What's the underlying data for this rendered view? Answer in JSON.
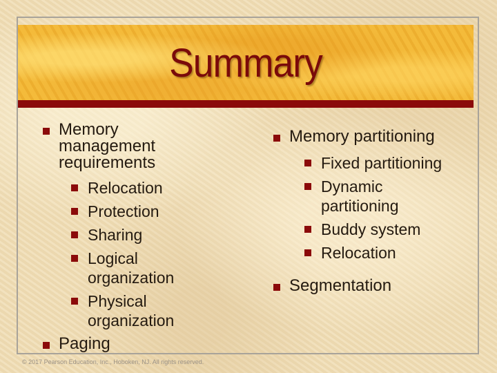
{
  "slide": {
    "title": "Summary",
    "footer": "© 2017 Pearson Education, Inc., Hoboken, NJ. All rights reserved.",
    "colors": {
      "title": "#7a0a0a",
      "bullet": "#8b0a0a",
      "banner": "#f2b632",
      "banner_bar": "#8b0a0a",
      "text": "#241a10",
      "background": "#efdcb4"
    },
    "bullet_icon": "square-bullet-icon"
  },
  "left": {
    "items": [
      {
        "label": "Memory management requirements",
        "children": [
          "Relocation",
          "Protection",
          "Sharing",
          "Logical organization",
          "Physical organization"
        ]
      },
      {
        "label": "Paging"
      }
    ]
  },
  "right": {
    "items": [
      {
        "label": "Memory partitioning",
        "children": [
          "Fixed partitioning",
          "Dynamic partitioning",
          "Buddy system",
          "Relocation"
        ]
      },
      {
        "label": "Segmentation"
      }
    ]
  }
}
